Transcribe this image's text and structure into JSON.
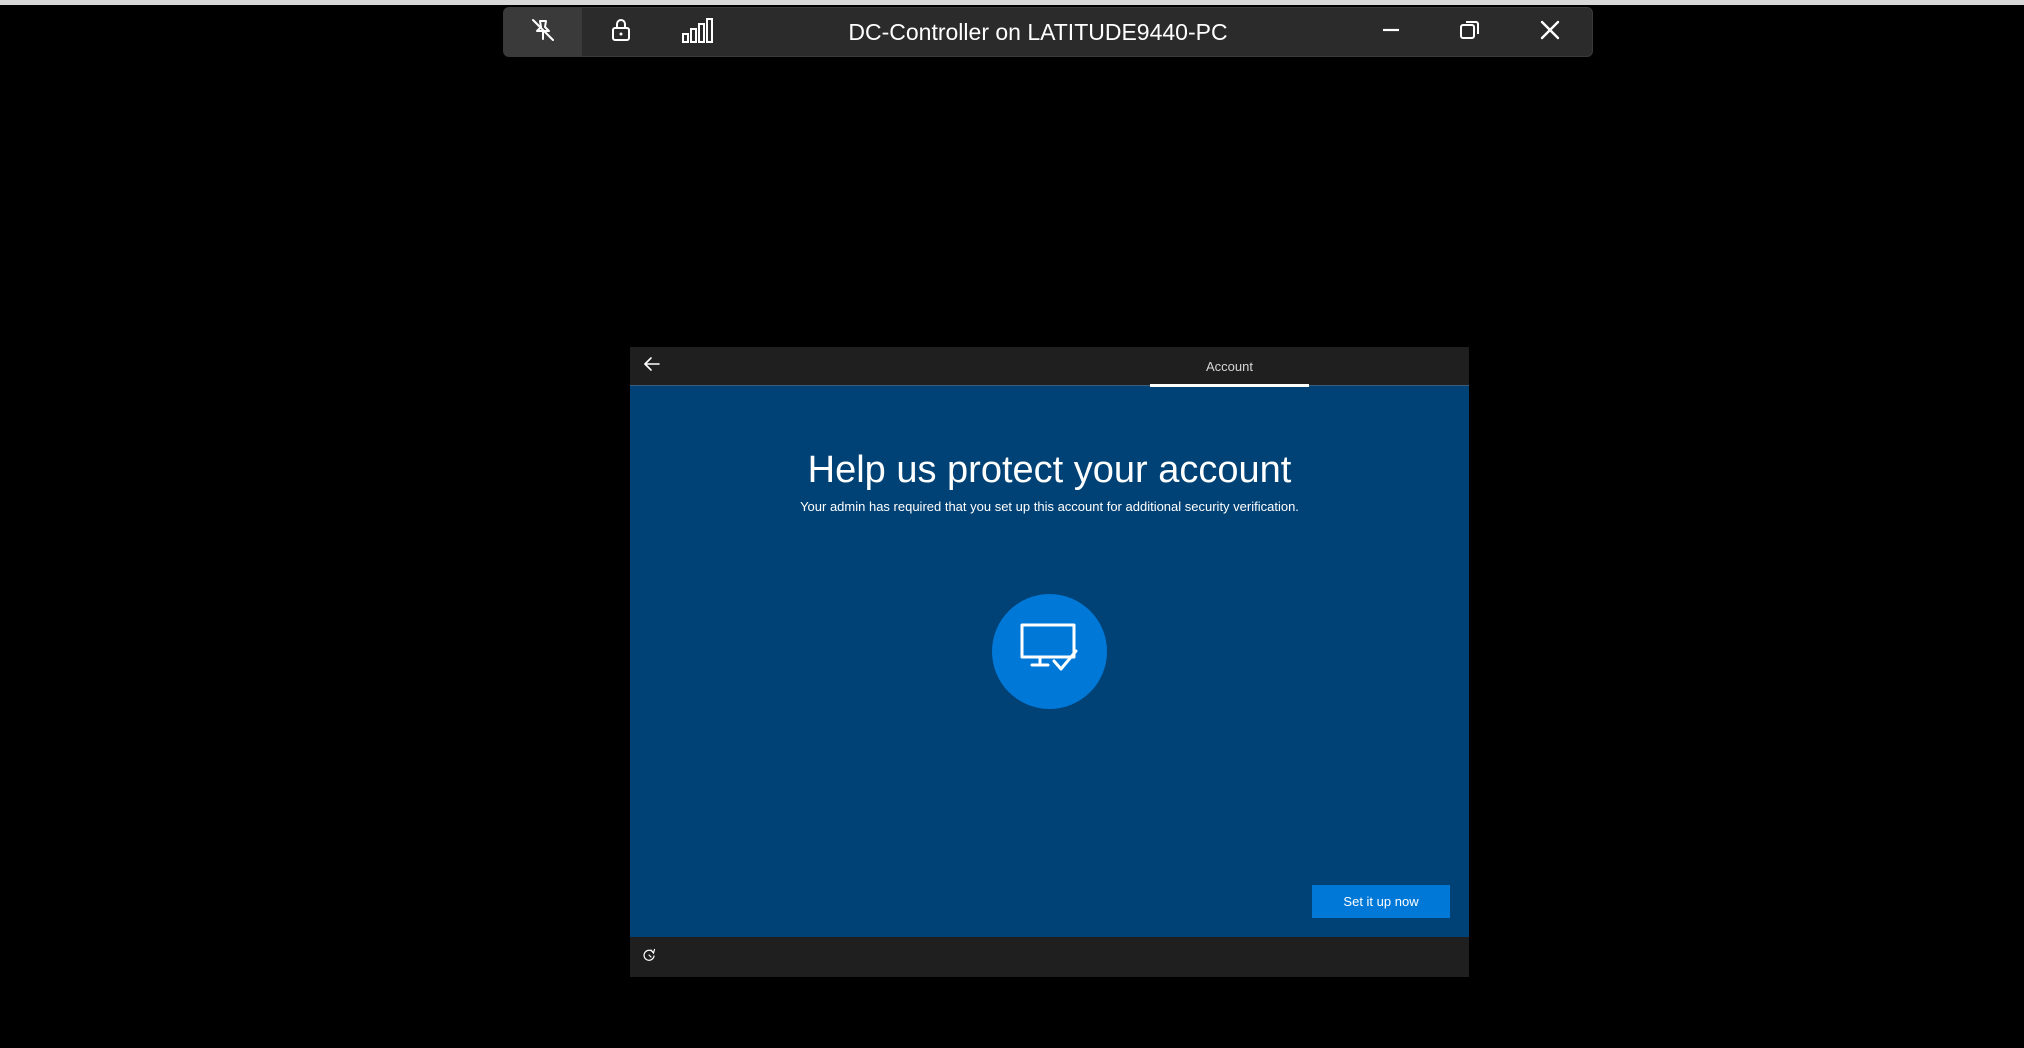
{
  "connection_bar": {
    "title": "DC-Controller on LATITUDE9440-PC",
    "icons": {
      "pin": "unpin-icon",
      "lock": "lock-icon",
      "signal": "signal-strength-icon",
      "minimize": "minimize-icon",
      "restore": "restore-icon",
      "close": "close-icon"
    }
  },
  "oobe": {
    "header": {
      "back_icon": "back-arrow-icon",
      "step_label": "Account"
    },
    "heading": "Help us protect your account",
    "subtext": "Your admin has required that you set up this account for additional security verification.",
    "hero_icon": "monitor-check-icon",
    "primary_button": "Set it up now",
    "footer": {
      "ease_of_access_icon": "ease-of-access-icon"
    }
  },
  "colors": {
    "background": "#000000",
    "oobe_blue": "#004275",
    "accent": "#0078d7",
    "bar": "#2b2b2b",
    "header": "#1f1f1f"
  }
}
